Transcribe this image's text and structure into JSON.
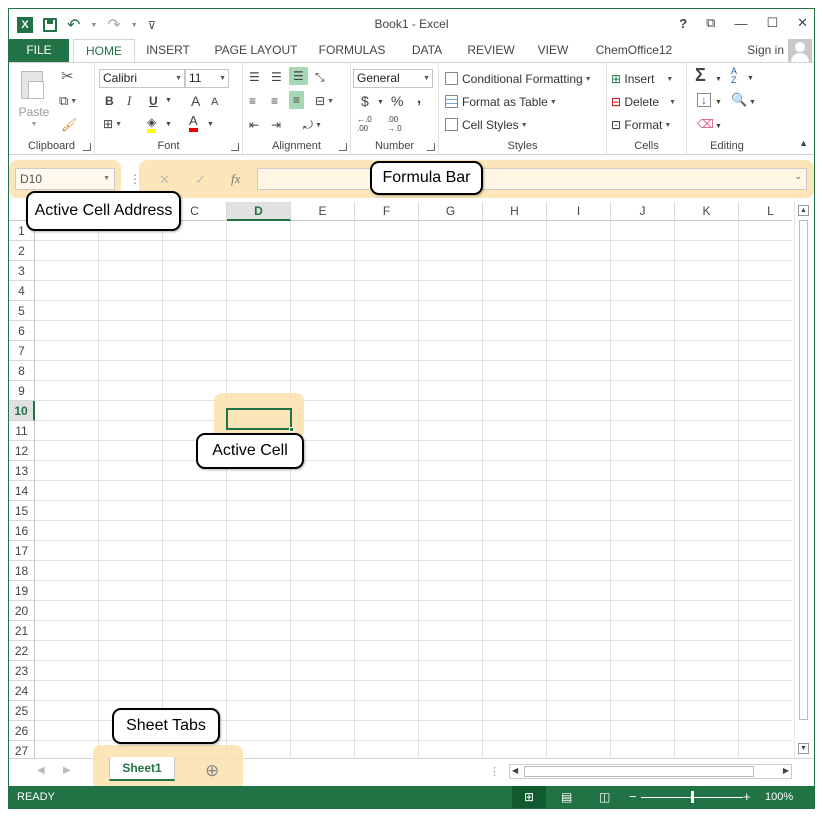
{
  "window": {
    "title": "Book1 - Excel",
    "help": "?",
    "restore_ribbon": "⧉",
    "minimize": "—",
    "maximize": "☐",
    "close": "✕"
  },
  "qat": {
    "app_icon": "X",
    "save_icon": "save-icon",
    "undo_icon": "↶",
    "redo_icon": "↷",
    "customize_icon": "⌄"
  },
  "tabs": {
    "file": "FILE",
    "home": "HOME",
    "insert": "INSERT",
    "page_layout": "PAGE LAYOUT",
    "formulas": "FORMULAS",
    "data": "DATA",
    "review": "REVIEW",
    "view": "VIEW",
    "chemoffice": "ChemOffice12",
    "sign_in": "Sign in"
  },
  "ribbon": {
    "clipboard": {
      "label": "Clipboard",
      "paste": "Paste"
    },
    "font": {
      "label": "Font",
      "name": "Calibri",
      "size": "11",
      "bold": "B",
      "italic": "I",
      "underline": "U",
      "grow": "A",
      "shrink": "A",
      "font_color": "A"
    },
    "alignment": {
      "label": "Alignment"
    },
    "number": {
      "label": "Number",
      "format": "General",
      "currency": "$",
      "percent": "%",
      "comma": ",",
      "inc_dec": "←.0 .00",
      "dec_dec": ".00 →.0"
    },
    "styles": {
      "label": "Styles",
      "conditional": "Conditional Formatting",
      "table": "Format as Table",
      "cell_styles": "Cell Styles"
    },
    "cells": {
      "label": "Cells",
      "insert": "Insert",
      "delete": "Delete",
      "format": "Format"
    },
    "editing": {
      "label": "Editing",
      "autosum": "Σ",
      "sort": "A Z",
      "find": "find-icon"
    }
  },
  "formula_bar": {
    "name_box": "D10",
    "cancel": "✕",
    "enter": "✓",
    "fx": "fx",
    "value": ""
  },
  "callouts": {
    "active_cell_address": "Active Cell Address",
    "formula_bar": "Formula Bar",
    "active_cell": "Active Cell",
    "sheet_tabs": "Sheet Tabs"
  },
  "grid": {
    "columns": [
      "C",
      "D",
      "E",
      "F",
      "G",
      "H",
      "I",
      "J",
      "K",
      "L"
    ],
    "rows": [
      "1",
      "2",
      "3",
      "4",
      "5",
      "6",
      "7",
      "8",
      "9",
      "10",
      "11",
      "12",
      "13",
      "14",
      "15",
      "16",
      "17",
      "18",
      "19",
      "20",
      "21",
      "22",
      "23",
      "24",
      "25",
      "26",
      "27"
    ],
    "active_column": "D",
    "active_row": "10"
  },
  "sheets": {
    "tabs": [
      "Sheet1"
    ],
    "add": "⊕"
  },
  "status": {
    "mode": "READY",
    "zoom_minus": "−",
    "zoom_plus": "+",
    "zoom": "100%",
    "zoom_level": 1.0
  },
  "colors": {
    "accent": "#217346",
    "highlight": "#fce0ad"
  }
}
